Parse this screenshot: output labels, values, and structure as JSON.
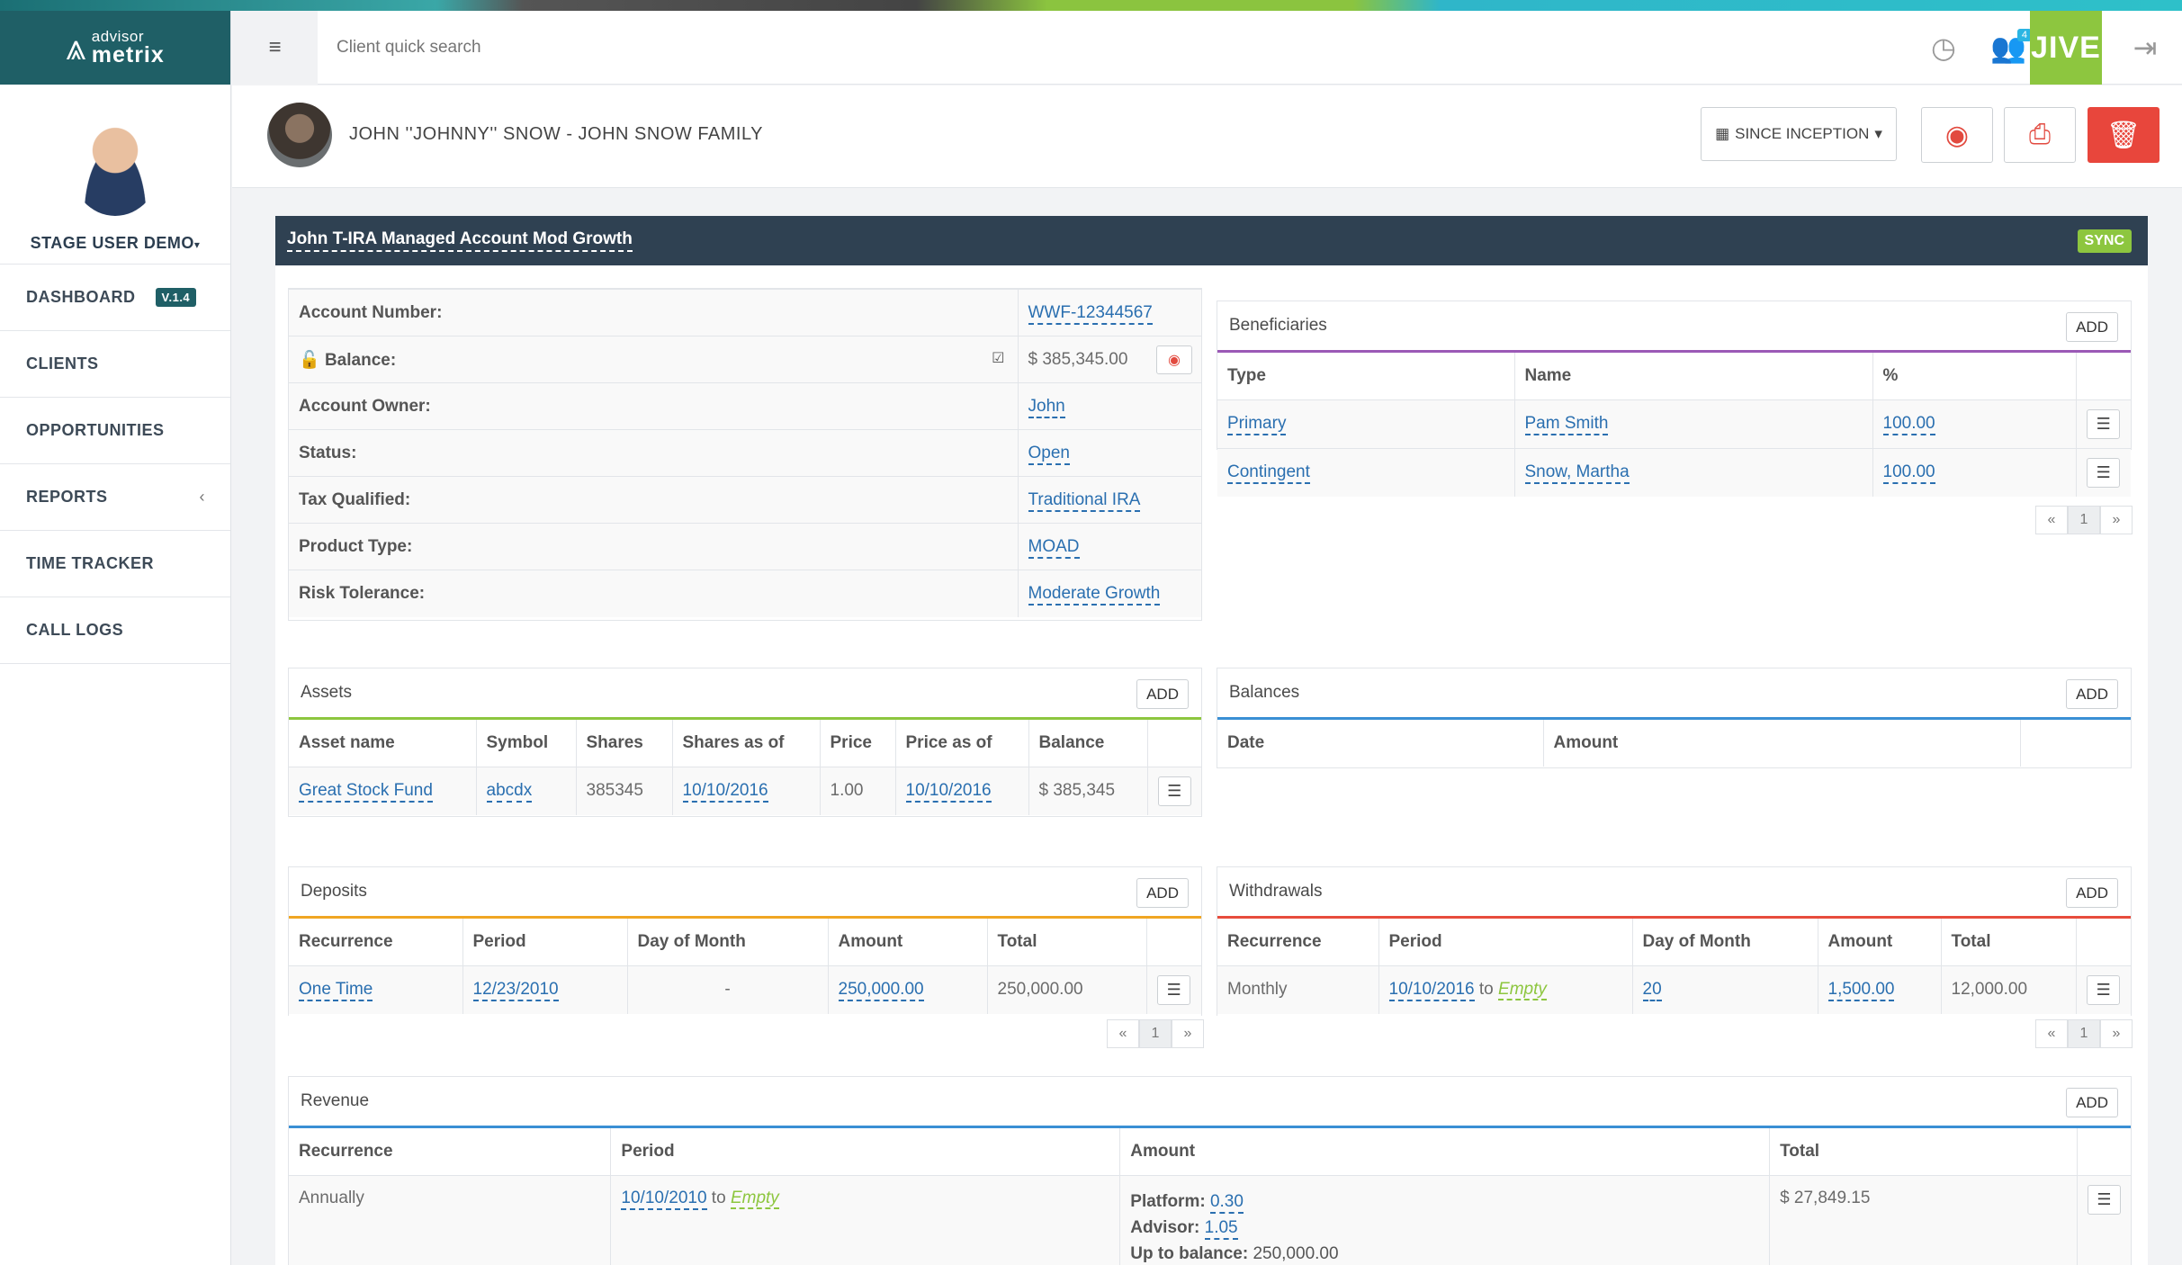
{
  "app": {
    "logo_small": "advisor",
    "logo_big": "metrix",
    "logo_mark": "⩓"
  },
  "sidebar": {
    "user": "STAGE USER DEMO",
    "items": [
      {
        "label": "DASHBOARD",
        "badge": "V.1.4"
      },
      {
        "label": "CLIENTS"
      },
      {
        "label": "OPPORTUNITIES"
      },
      {
        "label": "REPORTS",
        "caret": "‹"
      },
      {
        "label": "TIME TRACKER"
      },
      {
        "label": "CALL LOGS"
      }
    ]
  },
  "header": {
    "search_placeholder": "Client quick search",
    "notifications": "4",
    "jive": "JIVE"
  },
  "client": {
    "name": "JOHN ''JOHNNY'' SNOW - JOHN SNOW FAMILY",
    "range_label": "SINCE INCEPTION"
  },
  "account": {
    "title": "John T-IRA Managed Account Mod Growth",
    "sync": "SYNC",
    "fields": [
      {
        "label": "Account Number:",
        "value": "WWF-12344567"
      },
      {
        "label": "Balance:",
        "value": "$ 385,345.00"
      },
      {
        "label": "Account Owner:",
        "value": "John"
      },
      {
        "label": "Status:",
        "value": "Open"
      },
      {
        "label": "Tax Qualified:",
        "value": "Traditional IRA"
      },
      {
        "label": "Product Type:",
        "value": "MOAD"
      },
      {
        "label": "Risk Tolerance:",
        "value": "Moderate Growth"
      }
    ]
  },
  "beneficiaries": {
    "title": "Beneficiaries",
    "add": "ADD",
    "headers": [
      "Type",
      "Name",
      "%"
    ],
    "rows": [
      [
        "Primary",
        "Pam Smith",
        "100.00"
      ],
      [
        "Contingent",
        "Snow, Martha",
        "100.00"
      ]
    ],
    "pager": [
      "«",
      "1",
      "»"
    ]
  },
  "assets": {
    "title": "Assets",
    "add": "ADD",
    "headers": [
      "Asset name",
      "Symbol",
      "Shares",
      "Shares as of",
      "Price",
      "Price as of",
      "Balance"
    ],
    "rows": [
      [
        "Great Stock Fund",
        "abcdx",
        "385345",
        "10/10/2016",
        "1.00",
        "10/10/2016",
        "$ 385,345"
      ]
    ]
  },
  "balances": {
    "title": "Balances",
    "add": "ADD",
    "headers": [
      "Date",
      "Amount"
    ]
  },
  "deposits": {
    "title": "Deposits",
    "add": "ADD",
    "headers": [
      "Recurrence",
      "Period",
      "Day of Month",
      "Amount",
      "Total"
    ],
    "rows": [
      [
        "One Time",
        "12/23/2010",
        "-",
        "250,000.00",
        "250,000.00"
      ]
    ],
    "pager": [
      "«",
      "1",
      "»"
    ]
  },
  "withdrawals": {
    "title": "Withdrawals",
    "add": "ADD",
    "headers": [
      "Recurrence",
      "Period",
      "Day of Month",
      "Amount",
      "Total"
    ],
    "rows": [
      {
        "recurrence": "Monthly",
        "period_from": "10/10/2016",
        "to": "to",
        "period_to": "Empty",
        "day": "20",
        "amount": "1,500.00",
        "total": "12,000.00"
      }
    ],
    "pager": [
      "«",
      "1",
      "»"
    ]
  },
  "revenue": {
    "title": "Revenue",
    "add": "ADD",
    "headers": [
      "Recurrence",
      "Period",
      "Amount",
      "Total"
    ],
    "rows": [
      {
        "recurrence": "Annually",
        "period_from": "10/10/2010",
        "to": "to",
        "period_to": "Empty",
        "platform_label": "Platform:",
        "platform": "0.30",
        "advisor_label": "Advisor:",
        "advisor": "1.05",
        "upto_label": "Up to balance:",
        "upto": "250,000.00",
        "total": "$ 27,849.15"
      }
    ]
  }
}
